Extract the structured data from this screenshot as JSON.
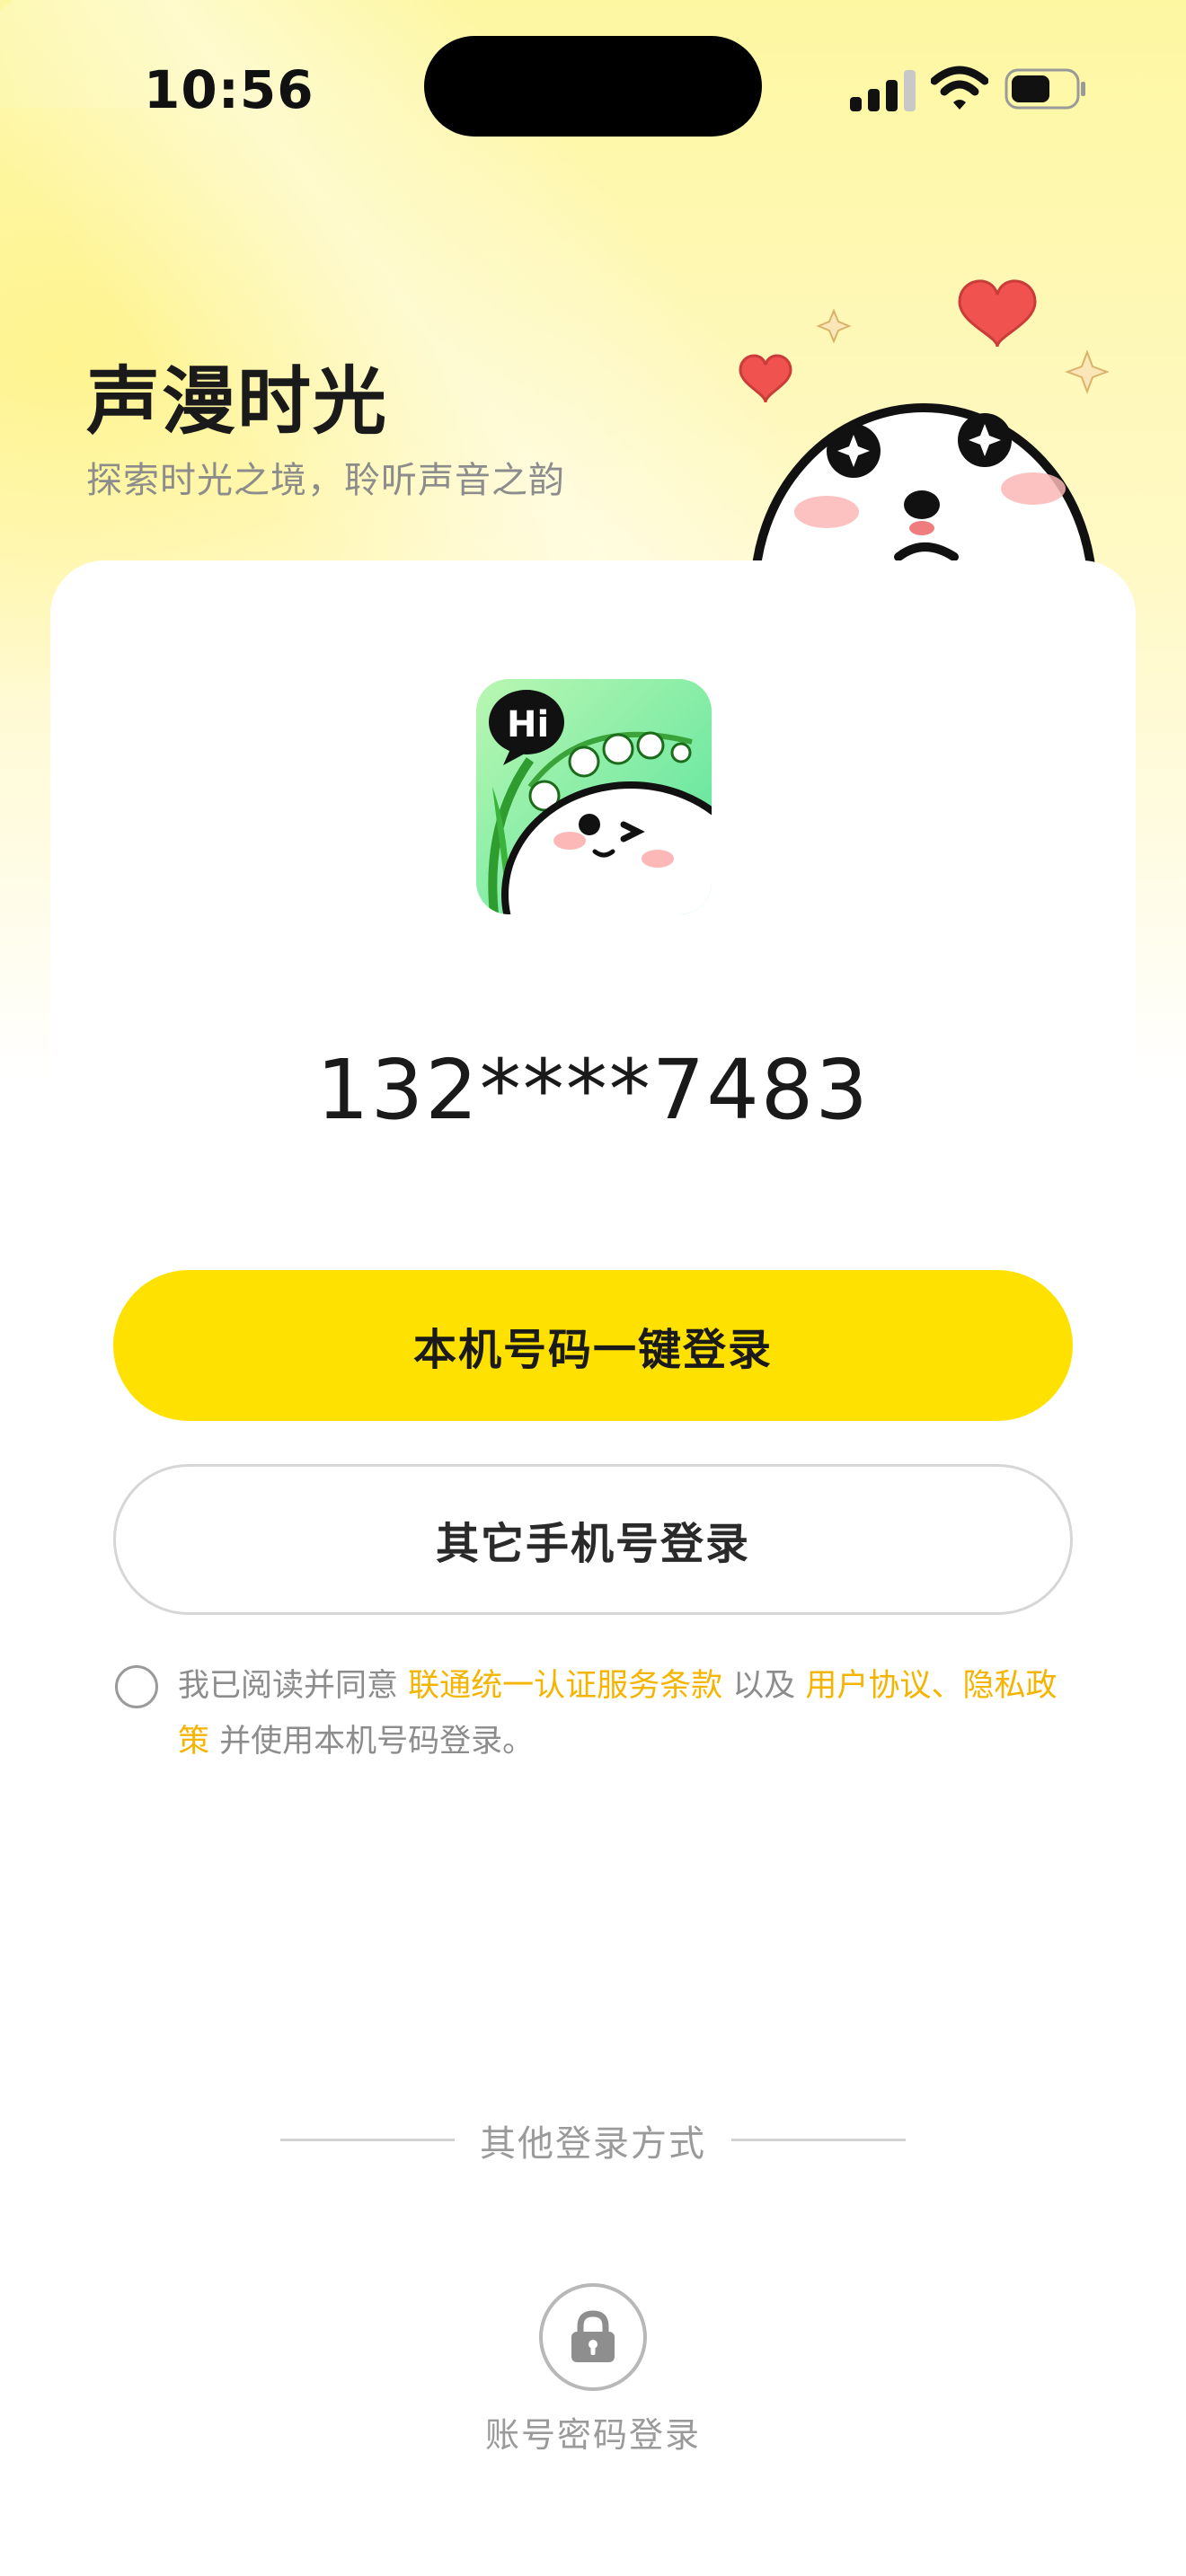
{
  "status_bar": {
    "time": "10:56"
  },
  "header": {
    "title": "声漫时光",
    "subtitle": "探索时光之境，聆听声音之韵"
  },
  "logo": {
    "bubble_text": "Hi"
  },
  "login": {
    "phone_number": "132****7483",
    "one_click_label": "本机号码一键登录",
    "other_phone_label": "其它手机号登录"
  },
  "agreement": {
    "checked": false,
    "prefix": "我已阅读并同意 ",
    "link_carrier": "联通统一认证服务条款",
    "middle": " 以及 ",
    "link_user": "用户协议",
    "separator": "、",
    "link_privacy": "隐私政策",
    "suffix": " 并使用本机号码登录。"
  },
  "other_login": {
    "divider_text": "其他登录方式",
    "password_login_label": "账号密码登录",
    "password_login_icon": "lock-icon"
  },
  "colors": {
    "accent": "#ffe100",
    "link": "#f5b400",
    "heart": "#f0524f"
  }
}
